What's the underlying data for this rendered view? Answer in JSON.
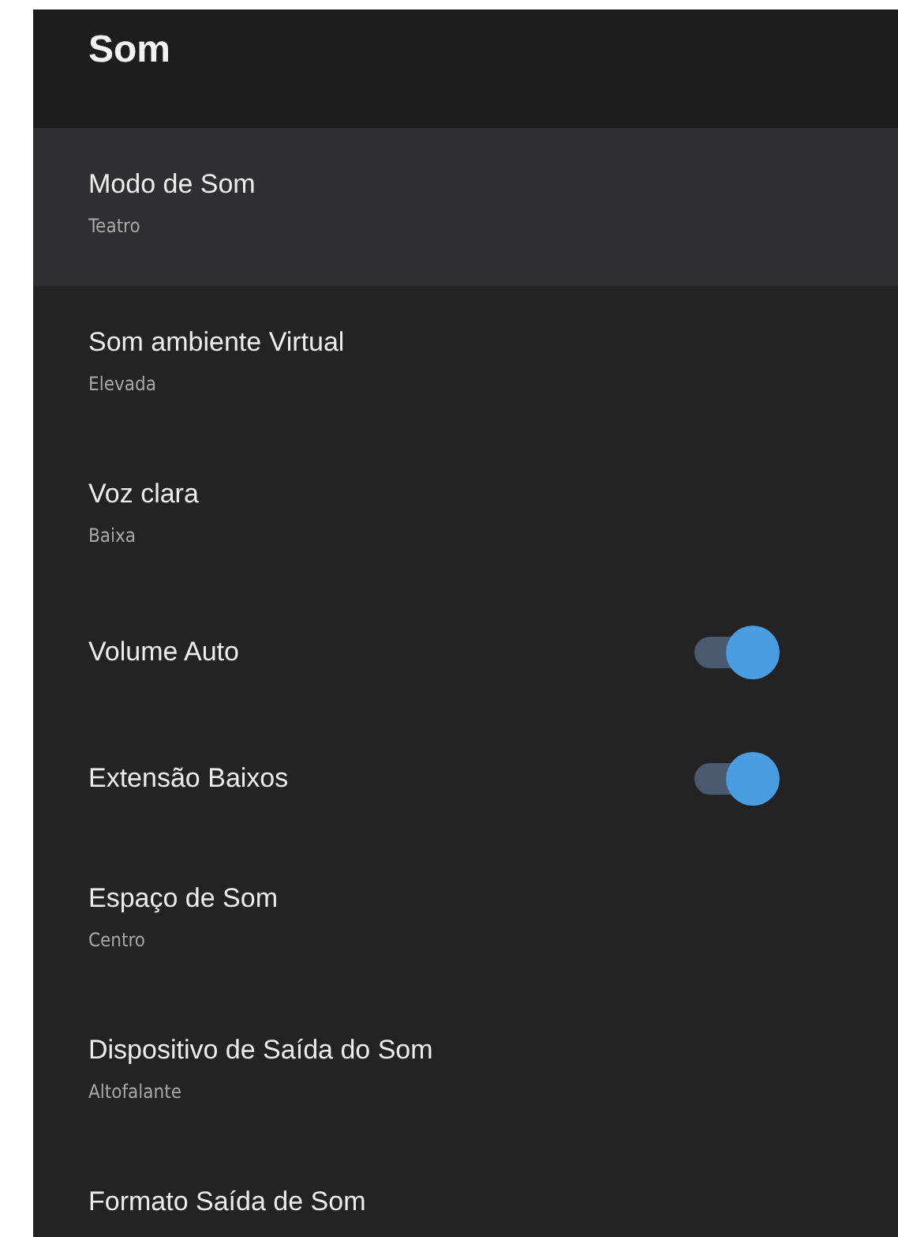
{
  "header": {
    "title": "Som"
  },
  "items": [
    {
      "kind": "choice",
      "label": "Modo de Som",
      "value": "Teatro",
      "selected": true
    },
    {
      "kind": "choice",
      "label": "Som ambiente Virtual",
      "value": "Elevada",
      "selected": false
    },
    {
      "kind": "choice",
      "label": "Voz clara",
      "value": "Baixa",
      "selected": false
    },
    {
      "kind": "toggle",
      "label": "Volume Auto",
      "on": true,
      "selected": false
    },
    {
      "kind": "toggle",
      "label": "Extensão Baixos",
      "on": true,
      "selected": false
    },
    {
      "kind": "choice",
      "label": "Espaço de Som",
      "value": "Centro",
      "selected": false
    },
    {
      "kind": "choice",
      "label": "Dispositivo de Saída do Som",
      "value": "Altofalante",
      "selected": false
    },
    {
      "kind": "choice",
      "label": "Formato Saída de Som",
      "selected": false
    }
  ]
}
